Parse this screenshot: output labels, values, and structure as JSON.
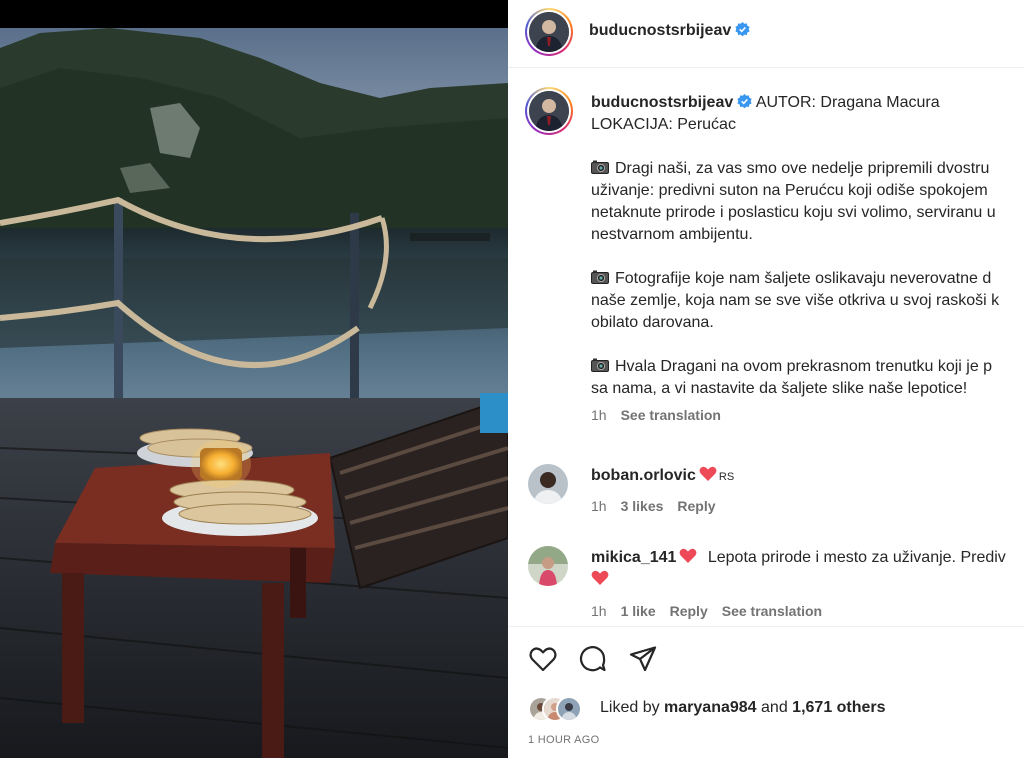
{
  "post": {
    "author": "buducnostsrbijeav",
    "verified": true
  },
  "caption": {
    "author": "buducnostsrbijeav",
    "line1": "AUTOR: Dragana Macura",
    "line2": "LOKACIJA: Perućac",
    "para1": [
      "Dragi naši, za vas smo ove nedelje pripremili dvostru",
      "uživanje: predivni suton na Perućcu koji odiše spokojem",
      "netaknute prirode i poslasticu koju svi volimo, serviranu u",
      "nestvarnom ambijentu."
    ],
    "para2": [
      "Fotografije koje nam šaljete oslikavaju neverovatne d",
      "naše zemlje, koja nam se sve više otkriva u svoj raskoši k",
      "obilato darovana."
    ],
    "para3": [
      "Hvala Dragani na ovom prekrasnom trenutku koji je p",
      "sa nama, a vi nastavite da šaljete slike naše lepotice!"
    ],
    "time": "1h",
    "see_translation": "See translation",
    "icon": "camera-emoji"
  },
  "comments": [
    {
      "user": "boban.orlovic",
      "text": "",
      "emoji": "red-heart",
      "flag": "RS",
      "time": "1h",
      "likes": "3 likes",
      "reply": "Reply"
    },
    {
      "user": "mikica_141",
      "text": "Lepota prirode i mesto za uživanje. Prediv",
      "emoji": "red-heart",
      "time": "1h",
      "likes": "1 like",
      "reply": "Reply",
      "see_translation": "See translation"
    }
  ],
  "actions": {
    "icons": [
      "heart-outline-icon",
      "comment-icon",
      "share-icon"
    ]
  },
  "likes": {
    "prefix": "Liked by",
    "user": "maryana984",
    "and": "and",
    "others": "1,671 others"
  },
  "timestamp": "1 HOUR AGO",
  "colors": {
    "verified": "#3897f0",
    "heart": "#ed4956",
    "muted": "#737373",
    "text": "#262626"
  }
}
